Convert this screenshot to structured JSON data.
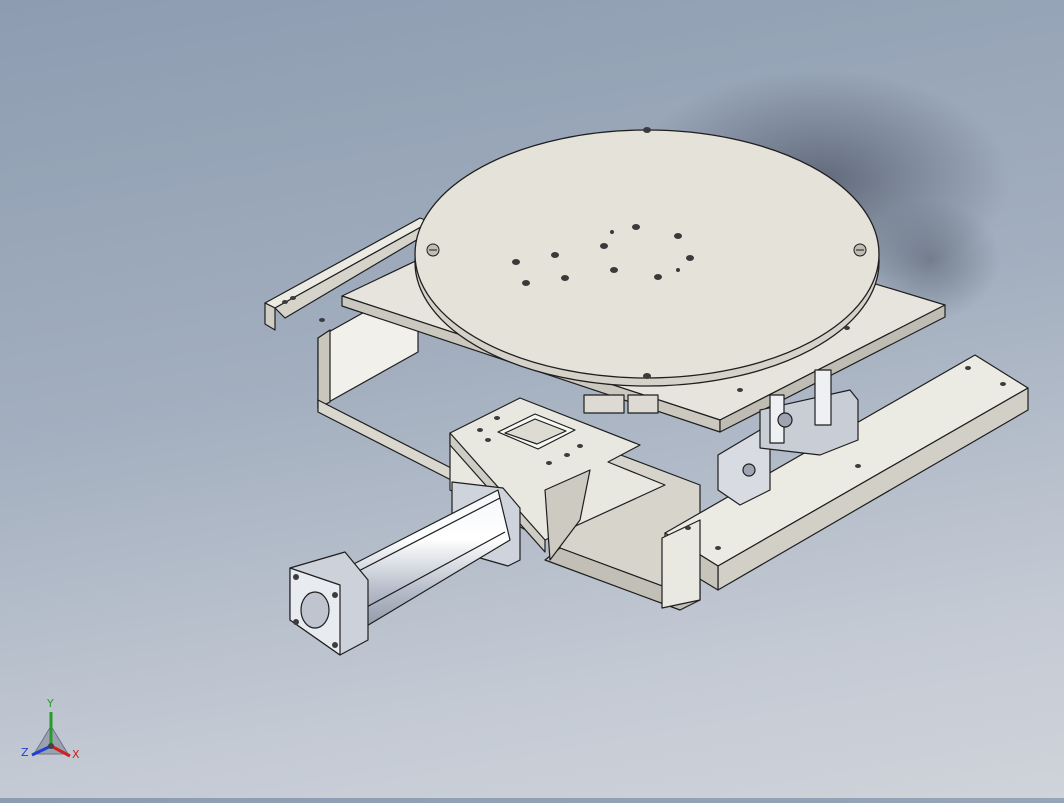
{
  "viewport": {
    "background_top": "#8d9cb1",
    "background_bottom": "#cfd3da",
    "part_color": "#e2e0d6",
    "shadow_color": "#6b7585",
    "metal_color": "#c8ccd6"
  },
  "triad": {
    "x_label": "X",
    "y_label": "Y",
    "z_label": "Z",
    "x_color": "#d02020",
    "y_color": "#2a9a2a",
    "z_color": "#2040d0"
  }
}
